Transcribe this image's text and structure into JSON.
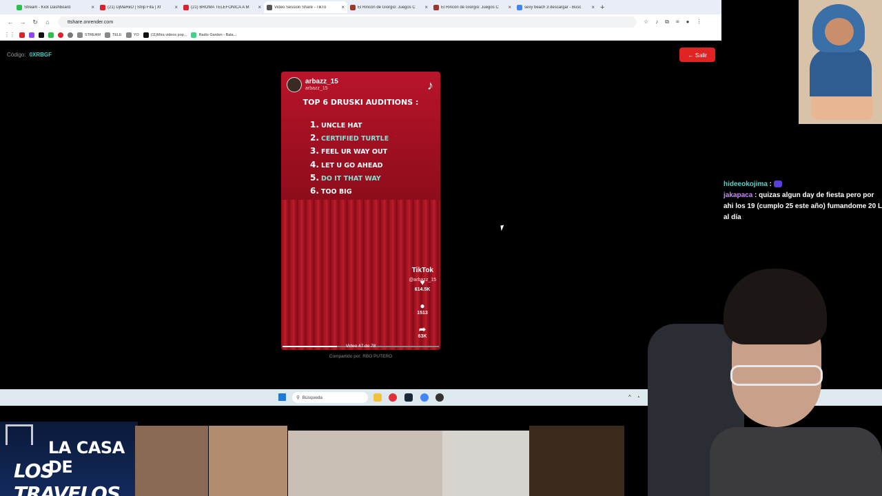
{
  "browser": {
    "tabs": [
      {
        "title": "Stream - Kick Dashboard",
        "color": "#28c24a",
        "active": false
      },
      {
        "title": "(21) DjMaRiiO | Strip Fifa | Xf",
        "color": "#e0202a",
        "active": false
      },
      {
        "title": "(21) BROMA TELEFÓNICA A M",
        "color": "#e0202a",
        "active": false
      },
      {
        "title": "Video Session Share - TikTo",
        "color": "#555555",
        "active": true
      },
      {
        "title": "El Rincón de Giorgio: Juegos C",
        "color": "#9b3a2a",
        "active": false
      },
      {
        "title": "El Rincón de Giorgio: Juegos C",
        "color": "#9b3a2a",
        "active": false
      },
      {
        "title": "sexy beach 3 descargar - Busc",
        "color": "#4285f4",
        "active": false
      }
    ],
    "url": "ttshare.onrender.com",
    "bookmarks": [
      {
        "label": "STREAM",
        "color": "#888888"
      },
      {
        "label": "TELE",
        "color": "#888888"
      },
      {
        "label": "YO",
        "color": "#888888"
      },
      {
        "label": "(11)Mira videos pop...",
        "color": "#111111"
      },
      {
        "label": "Radio Garden - Bala...",
        "color": "#3fd38a"
      }
    ]
  },
  "page": {
    "code_label": "Código:",
    "code_value": "0XRBGF",
    "exit_label": "← Salir",
    "shared_by": "Compartido por: RBO PUTERO"
  },
  "video": {
    "username": "arbazz_15",
    "handle": "arbazz_15",
    "title": "TOP 6 DRUSKI AUDITIONS :",
    "items": [
      {
        "num": "1.",
        "text": "UNCLE HAT",
        "highlight": false
      },
      {
        "num": "2.",
        "text": "CERTIFIED TURTLE",
        "highlight": true
      },
      {
        "num": "3.",
        "text": "FEEL UR WAY OUT",
        "highlight": false
      },
      {
        "num": "4.",
        "text": "LET U GO AHEAD",
        "highlight": false
      },
      {
        "num": "5.",
        "text": "DO IT THAT WAY",
        "highlight": true
      },
      {
        "num": "6.",
        "text": "TOO  BIG",
        "highlight": false
      }
    ],
    "watermark": "TikTok",
    "watermark_handle": "@arbazz_15",
    "likes": "614.5K",
    "comments": "1513",
    "shares": "63K",
    "counter": "Video 47 de 78",
    "progress": 0.35
  },
  "taskbar": {
    "search_placeholder": "Búsqueda"
  },
  "chat": [
    {
      "user": "hideeokojima",
      "text": "",
      "emote": true
    },
    {
      "user": "jakapaca",
      "text": "quizas algun day de fiesta pero por ahi los 19 (cumplo 25 este año) fumandome 20 L al día"
    }
  ],
  "overlay": {
    "logo_line1": "LA CASA DE",
    "logo_line2": "LOS TRAVELOS"
  }
}
